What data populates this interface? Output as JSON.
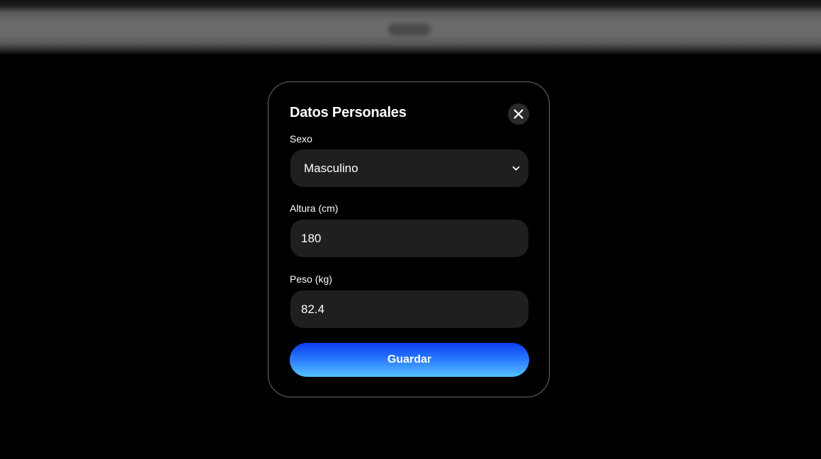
{
  "modal": {
    "title": "Datos Personales",
    "close_icon": "close-icon",
    "fields": {
      "sexo": {
        "label": "Sexo",
        "value": "Masculino",
        "icon": "chevron-down-icon"
      },
      "altura": {
        "label": "Altura (cm)",
        "value": "180"
      },
      "peso": {
        "label": "Peso (kg)",
        "value": "82.4"
      }
    },
    "save_label": "Guardar"
  },
  "colors": {
    "background": "#000000",
    "field_background": "#1f1f1f",
    "modal_border": "#6b6b6b",
    "accent_top": "#0a3ef0",
    "accent_bottom": "#56c4ff"
  }
}
